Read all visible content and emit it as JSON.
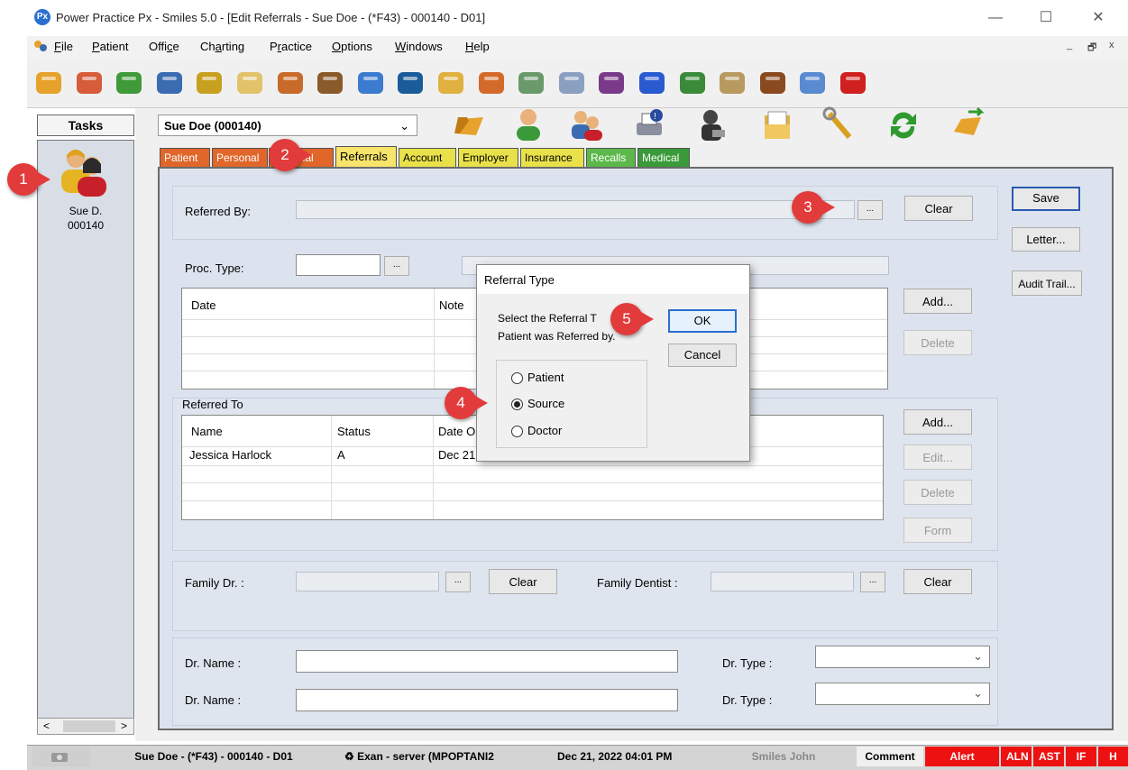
{
  "window": {
    "logo_text": "Px",
    "title": "Power Practice Px - Smiles 5.0 - [Edit Referrals - Sue Doe - (*F43) - 000140 - D01]",
    "controls": [
      "—",
      "☐",
      "✕"
    ],
    "mdi_controls": [
      "_",
      "🗗",
      "x"
    ]
  },
  "menu": {
    "items": [
      {
        "prefix": "",
        "ul": "F",
        "rest": "ile"
      },
      {
        "prefix": "",
        "ul": "P",
        "rest": "atient"
      },
      {
        "prefix": "Offi",
        "ul": "c",
        "rest": "e"
      },
      {
        "prefix": "Ch",
        "ul": "a",
        "rest": "rting"
      },
      {
        "prefix": "P",
        "ul": "r",
        "rest": "actice"
      },
      {
        "prefix": "",
        "ul": "O",
        "rest": "ptions"
      },
      {
        "prefix": "",
        "ul": "W",
        "rest": "indows"
      },
      {
        "prefix": "",
        "ul": "H",
        "rest": "elp"
      }
    ]
  },
  "toolbar_icons": [
    "open-folder-icon",
    "patients-icon",
    "billing-icon",
    "book-icon",
    "edit-icon",
    "document-icon",
    "chart-grid-icon",
    "scan-icon",
    "prescription-icon",
    "imaging-icon",
    "folders-icon",
    "gifts-icon",
    "report-icon",
    "calculator-icon",
    "edi-icon",
    "info-icon",
    "reminder-icon",
    "notes-icon",
    "football-icon",
    "chat-icon",
    "exit-icon"
  ],
  "toolbar_colors": [
    "#e6a22a",
    "#d65c3a",
    "#3f9a3a",
    "#3b6bb0",
    "#c8a020",
    "#e2c36a",
    "#c86a2a",
    "#8a5a2a",
    "#3b7bd0",
    "#1a5b9a",
    "#e0b040",
    "#d46a2a",
    "#6a9a6a",
    "#8aa0c0",
    "#7a3a8a",
    "#2a5ad0",
    "#3a8a3a",
    "#b89a60",
    "#8a4a20",
    "#5a8ad0",
    "#d02020"
  ],
  "tasks": {
    "header": "Tasks",
    "patient_name": "Sue D.",
    "patient_id": "000140",
    "scroll_left": "<",
    "scroll_right": ">"
  },
  "patient_select": {
    "value": "Sue Doe (000140)"
  },
  "tabs": [
    {
      "label": "Patient",
      "color": "#e0662a"
    },
    {
      "label": "Personal",
      "color": "#e0662a"
    },
    {
      "label": "Optional",
      "color": "#e0662a"
    },
    {
      "label": "Referrals",
      "color": "#f7e46a",
      "active": true
    },
    {
      "label": "Account",
      "color": "#e8e14a"
    },
    {
      "label": "Employer",
      "color": "#e8e14a"
    },
    {
      "label": "Insurance",
      "color": "#e8e14a"
    },
    {
      "label": "Recalls",
      "color": "#5cb84a"
    },
    {
      "label": "Medical",
      "color": "#3a9a3a"
    }
  ],
  "referrals": {
    "referred_by_label": "Referred By:",
    "ellipsis": "...",
    "clear": "Clear",
    "proc_type_label": "Proc. Type:",
    "notes_grid": {
      "columns": [
        "Date",
        "Note"
      ]
    },
    "add": "Add...",
    "delete": "Delete",
    "edit": "Edit...",
    "form": "Form",
    "referred_to_label": "Referred To",
    "referred_to_grid": {
      "columns": [
        "Name",
        "Status",
        "Date O"
      ],
      "rows": [
        [
          "Jessica Harlock",
          "A",
          "Dec 21"
        ]
      ]
    },
    "family_dr_label": "Family Dr. :",
    "family_dentist_label": "Family Dentist :",
    "dr_name_label": "Dr. Name :",
    "dr_type_label": "Dr. Type :"
  },
  "side_buttons": {
    "save": "Save",
    "letter": "Letter...",
    "audit": "Audit Trail..."
  },
  "dialog": {
    "title": "Referral Type",
    "prompt_line1": "Select the Referral T",
    "prompt_line2": "Patient was Referred by.",
    "ok": "OK",
    "cancel": "Cancel",
    "options": [
      "Patient",
      "Source",
      "Doctor"
    ],
    "selected": "Source"
  },
  "callouts": [
    "1",
    "2",
    "3",
    "4",
    "5"
  ],
  "statusbar": {
    "patient": "Sue Doe - (*F43) - 000140 - D01",
    "server": "Exan - server (MPOPTANI2",
    "datetime": "Dec 21, 2022 04:01 PM",
    "user": "Smiles John",
    "comment": "Comment",
    "alert": "Alert",
    "flags": [
      "ALN",
      "AST",
      "IF",
      "H"
    ]
  }
}
